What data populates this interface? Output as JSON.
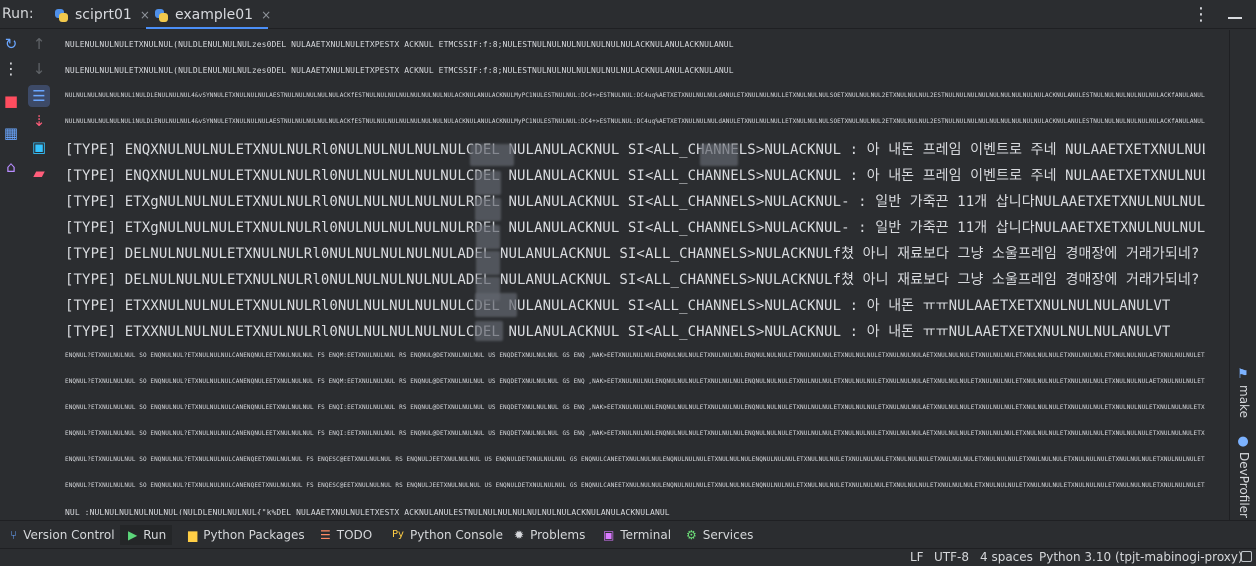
{
  "topbar": {
    "run_label": "Run:",
    "tabs": [
      {
        "label": "sciprt01",
        "active": false,
        "icon": "python-icon",
        "close_icon": "close-icon"
      },
      {
        "label": "example01",
        "active": true,
        "icon": "python-icon",
        "close_icon": "close-icon"
      }
    ],
    "actions": {
      "more_icon": "⋮",
      "minimize_icon": "minimize-icon"
    }
  },
  "left_toolbar": {
    "tools": [
      {
        "name": "rerun-icon",
        "glyph": "↻",
        "active": false,
        "color": "#6aa6ff"
      },
      {
        "name": "more-icon",
        "glyph": "⋮",
        "active": false,
        "color": "#d7d9dd"
      },
      {
        "name": "stop-icon",
        "glyph": "■",
        "active": false,
        "color": "#ff4d5f"
      },
      {
        "name": "layout-icon",
        "glyph": "▦",
        "active": false,
        "color": "#6aa6ff"
      },
      {
        "name": "pin-icon",
        "glyph": "⌂",
        "active": false,
        "color": "#b88cff"
      },
      {
        "name": "scroll-up-icon",
        "glyph": "↑",
        "active": false,
        "color": "#606468"
      },
      {
        "name": "scroll-down-icon",
        "glyph": "↓",
        "active": false,
        "color": "#606468"
      },
      {
        "name": "soft-wrap-icon",
        "glyph": "☰",
        "active": true,
        "color": "#6aa6ff"
      },
      {
        "name": "download-icon",
        "glyph": "⇣",
        "active": false,
        "color": "#ff5d7a"
      },
      {
        "name": "print-icon",
        "glyph": "▣",
        "active": false,
        "color": "#34c3ff"
      },
      {
        "name": "trash-icon",
        "glyph": "▰",
        "active": false,
        "color": "#ff5d7a"
      }
    ]
  },
  "console": {
    "lines": [
      "NULENULNULNULETXNULNUL(NULDLENULNULNULzes0DEL NULAAETXNULNULETXPESTX ACKNUL ETMCSSIF:f:8;NULESTNULNULNULNULNULNULNULACKNULANULACKNULANUL",
      "NULENULNULNULETXNULNUL(NULDLENULNULNULzes0DEL NULAAETXNULNULETXPESTX ACKNUL ETMCSSIF:f:8;NULESTNULNULNULNULNULNULNULACKNULANULACKNULANUL",
      "NULNULNULNULNULNULiNULDLENULNULNUL4&vSYNNULETXNULNULNULAESTNULNULNULNULNULACKfESTNULNULNULNULNULNULNULNULACKNULANULACKNULMyPC1NULESTNULNUL:DC4+>ESTNULNUL:DC4uq%AETXETXNULNULNULdANULETXNULNULNULLETXNULNULNULSOETXNULNULNUL2ETXNULNULNUL2ESTNULNULNULNULNULNULNULNULNULACKNULANULESTNULNULNULNULNULNULACKfANULANULANULANUL",
      "NULNULNULNULNULNULiNULDLENULNULNUL4&vSYNNULETXNULNULNULAESTNULNULNULNULNULACKfESTNULNULNULNULNULNULNULNULACKNULANULACKNULMyPC1NULESTNULNUL:DC4+>ESTNULNUL:DC4uq%AETXETXNULNULNULdANULETXNULNULNULLETXNULNULNULSOETXNULNULNUL2ETXNULNULNUL2ESTNULNULNULNULNULNULNULNULNULACKNULANULESTNULNULNULNULNULNULACKfANULANULANULANUL",
      "[TYPE] ENQXNULNULNULETXNULNULRl0NULNULNULNULNULCDEL NULANULACKNUL SI<ALL_CHANNELS>NULACKNUL       : 아 내돈 프레임 이벤트로 주네       NULAAETXETXNULNULNULANULVT",
      "[TYPE] ENQXNULNULNULETXNULNULRl0NULNULNULNULNULCDEL NULANULACKNUL SI<ALL_CHANNELS>NULACKNUL       : 아 내돈 프레임 이벤트로 주네       NULAAETXETXNULNULNULANULVT",
      "[TYPE] ETXgNULNULNULETXNULNULRl0NULNULNULNULNULRDEL NULANULACKNUL SI<ALL_CHANNELS>NULACKNUL-       : 일반 가죽끈 11개 삽니다NULAAETXETXNULNULNULANULVT",
      "[TYPE] ETXgNULNULNULETXNULNULRl0NULNULNULNULNULRDEL NULANULACKNUL SI<ALL_CHANNELS>NULACKNUL-       : 일반 가죽끈 11개 삽니다NULAAETXETXNULNULNULANULVT",
      "[TYPE] DELNULNULNULETXNULNULRl0NULNULNULNULNULADEL NULANULACKNUL SI<ALL_CHANNELS>NULACKNULf쳤       아니 재료보다 그냥 소울프레임 경매장에 거래가되네? 와중에 싸나NULAAETXETXNULNULNULANULVT",
      "[TYPE] DELNULNULNULETXNULNULRl0NULNULNULNULNULADEL NULANULACKNUL SI<ALL_CHANNELS>NULACKNULf쳤       아니 재료보다 그냥 소울프레임 경매장에 거래가되네? 와중에 싸나NULAAETXETXNULNULNULANULVT",
      "[TYPE] ETXXNULNULNULETXNULNULRl0NULNULNULNULNULCDEL NULANULACKNUL SI<ALL_CHANNELS>NULACKNUL       : 아 내돈 ㅠㅠNULAAETXETXNULNULNULANULVT",
      "[TYPE] ETXXNULNULNULETXNULNULRl0NULNULNULNULNULCDEL NULANULACKNUL SI<ALL_CHANNELS>NULACKNUL       : 아 내돈 ㅠㅠNULAAETXETXNULNULNULANULVT",
      "ENQNUL?ETXNULNULNUL SO ENQNULNUL?ETXNULNULNULCANENQNULEETXNULNULNUL FS ENQM:EETXNULNULNUL RS ENQNUL@DETXNULNULNUL US ENQDETXNULNULNUL GS ENQ ,NAK>EETXNULNULNULENQNULNULNULETXNULNULNULENQNULNULNULETXNULNULNULETXNULNULNULETXNULNULNULAETXNULNULNULETXNULNULNULETXNULNULNULETXNULNULNULETXNULNULNULAETXNULNULNULETXNULNULNUL",
      "ENQNUL?ETXNULNULNUL SO ENQNULNUL?ETXNULNULNULCANENQNULEETXNULNULNUL FS ENQM:EETXNULNULNUL RS ENQNUL@DETXNULNULNUL US ENQDETXNULNULNUL GS ENQ ,NAK>EETXNULNULNULENQNULNULNULETXNULNULNULENQNULNULNULETXNULNULNULETXNULNULNULETXNULNULNULAETXNULNULNULETXNULNULNULETXNULNULNULETXNULNULNULETXNULNULNULAETXNULNULNULETXNULNULNUL",
      "ENQNUL?ETXNULNULNUL SO ENQNULNUL?ETXNULNULNULCANENQNULEETXNULNULNUL FS ENQI:EETXNULNULNUL RS ENQNUL@DETXNULNULNUL US ENQDETXNULNULNUL GS ENQ ,NAK>EETXNULNULNULENQNULNULNULETXNULNULNULENQNULNULNULETXNULNULNULETXNULNULNULETXNULNULNULAETXNULNULNULETXNULNULNULETXNULNULNULETXNULNULNULETXNULNULNULETXNULNULNULETXNULNULNUL",
      "ENQNUL?ETXNULNULNUL SO ENQNULNUL?ETXNULNULNULCANENQNULEETXNULNULNUL FS ENQI:EETXNULNULNUL RS ENQNUL@DETXNULNULNUL US ENQDETXNULNULNUL GS ENQ ,NAK>EETXNULNULNULENQNULNULNULETXNULNULNULENQNULNULNULETXNULNULNULETXNULNULNULETXNULNULNULAETXNULNULNULETXNULNULNULETXNULNULNULETXNULNULNULETXNULNULNULETXNULNULNULETXNULNULNUL",
      "ENQNUL?ETXNULNULNUL SO ENQNULNUL?ETXNULNULNULCANENQEETXNULNULNUL FS ENQESC@EETXNULNULNUL RS ENQNULJEETXNULNULNUL US ENQNULDETXNULNULNUL GS ENQNULCANEETXNULNULNULENQNULNULNULETXNULNULNULENQNULNULNULETXNULNULNULETXNULNULNULETXNULNULNULETXNULNULNULETXNULNULNULETXNULNULNULETXNULNULNULETXNULNULNULETXNULNULNULETXNULNULNULETXNULNULNUL",
      "ENQNUL?ETXNULNULNUL SO ENQNULNUL?ETXNULNULNULCANENQEETXNULNULNUL FS ENQESC@EETXNULNULNUL RS ENQNULJEETXNULNULNUL US ENQNULDETXNULNULNUL GS ENQNULCANEETXNULNULNULENQNULNULNULETXNULNULNULENQNULNULNULETXNULNULNULETXNULNULNULETXNULNULNULETXNULNULNULETXNULNULNULETXNULNULNULETXNULNULNULETXNULNULNULETXNULNULNULETXNULNULNULETXNULNULNUL",
      "NUL :NULNULNULNULNULNUL(NULDLENULNULNUL{\"k%DEL NULAAETXNULNULETXESTX ACKNULANULESTNULNULNULNULNULNULNULACKNULANULACKNULANUL"
    ]
  },
  "bottom_toolbar": {
    "items": [
      {
        "name": "version-control",
        "label": "Version Control",
        "icon": "branch-icon",
        "icon_glyph": "⑂",
        "icon_color": "#6aa6ff"
      },
      {
        "name": "run",
        "label": "Run",
        "icon": "play-icon",
        "icon_glyph": "▶",
        "icon_color": "#5cd67a"
      },
      {
        "name": "python-packages",
        "label": "Python Packages",
        "icon": "package-icon",
        "icon_glyph": "▆",
        "icon_color": "#ffce45"
      },
      {
        "name": "todo",
        "label": "TODO",
        "icon": "todo-icon",
        "icon_glyph": "☰",
        "icon_color": "#ff8a65"
      },
      {
        "name": "python-console",
        "label": "Python Console",
        "icon": "python-console-icon",
        "icon_glyph": "Py",
        "icon_color": "#ffce45"
      },
      {
        "name": "problems",
        "label": "Problems",
        "icon": "bug-icon",
        "icon_glyph": "✹",
        "icon_color": "#d7d9dd"
      },
      {
        "name": "terminal",
        "label": "Terminal",
        "icon": "terminal-icon",
        "icon_glyph": "▣",
        "icon_color": "#d979ff"
      },
      {
        "name": "services",
        "label": "Services",
        "icon": "services-icon",
        "icon_glyph": "⚙",
        "icon_color": "#6ee07a"
      }
    ]
  },
  "right_rail": {
    "items": [
      {
        "label": "make",
        "icon": "make-icon",
        "icon_glyph": "⚑"
      },
      {
        "label": "DevProfiler",
        "icon": "profiler-icon",
        "icon_glyph": "👤"
      }
    ]
  },
  "statusbar": {
    "line_separator": "LF",
    "encoding": "UTF-8",
    "indent": "4 spaces",
    "interpreter": "Python 3.10 (tpjt-mabinogi-proxy)",
    "lock_icon": "lock-icon"
  }
}
